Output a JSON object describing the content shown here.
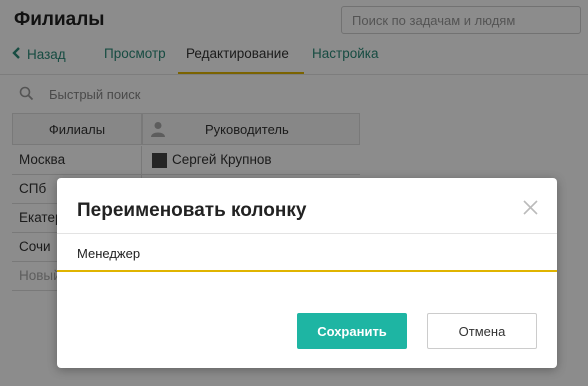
{
  "app": {
    "title": "Филиалы"
  },
  "search": {
    "placeholder": "Поиск по задачам и людям"
  },
  "nav": {
    "back_label": "Назад",
    "tabs": [
      {
        "label": "Просмотр",
        "active": false
      },
      {
        "label": "Редактирование",
        "active": true
      },
      {
        "label": "Настройка",
        "active": false
      }
    ]
  },
  "quick_search": {
    "placeholder": "Быстрый поиск"
  },
  "table": {
    "columns": [
      "Филиалы",
      "Руководитель"
    ],
    "rows": [
      {
        "branch": "Москва",
        "manager": "Сергей Крупнов"
      },
      {
        "branch": "СПб",
        "manager": ""
      },
      {
        "branch": "Екатеринбург",
        "manager": ""
      },
      {
        "branch": "Сочи",
        "manager": ""
      }
    ],
    "new_row_label": "Новый"
  },
  "dialog": {
    "title": "Переименовать колонку",
    "input_value": "Менеджер",
    "save_label": "Сохранить",
    "cancel_label": "Отмена"
  },
  "colors": {
    "accent": "#1eb5a3",
    "link": "#2a8a78",
    "underline": "#e0b400"
  },
  "icons": {
    "back": "chevron-left-icon",
    "quick_search": "search-icon",
    "column_person": "person-icon",
    "avatar": "avatar",
    "close": "close-icon"
  }
}
